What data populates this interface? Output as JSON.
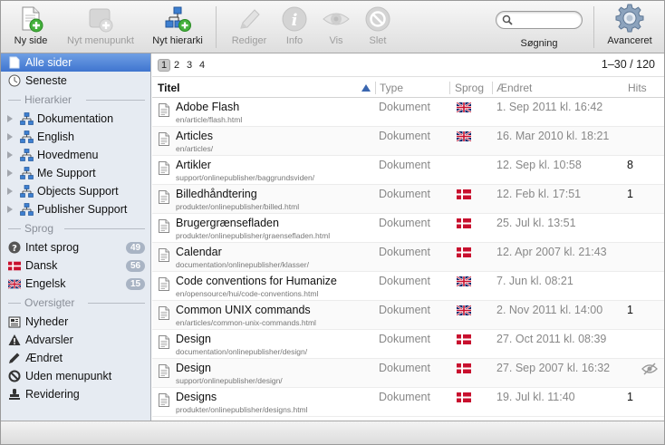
{
  "toolbar": {
    "new_page": "Ny side",
    "new_menu_item": "Nyt menupunkt",
    "new_hierarchy": "Nyt hierarki",
    "edit": "Rediger",
    "info": "Info",
    "view": "Vis",
    "delete": "Slet",
    "search_label": "Søgning",
    "search_value": "",
    "advanced": "Avanceret"
  },
  "sidebar": {
    "all_pages": "Alle sider",
    "recent": "Seneste",
    "hierarchies_heading": "Hierarkier",
    "hierarchies": [
      "Dokumentation",
      "English",
      "Hovedmenu",
      "Me Support",
      "Objects Support",
      "Publisher Support"
    ],
    "languages_heading": "Sprog",
    "languages": [
      {
        "label": "Intet sprog",
        "count": "49"
      },
      {
        "label": "Dansk",
        "count": "56"
      },
      {
        "label": "Engelsk",
        "count": "15"
      }
    ],
    "overviews_heading": "Oversigter",
    "overviews": [
      "Nyheder",
      "Advarsler",
      "Ændret",
      "Uden menupunkt",
      "Revidering"
    ]
  },
  "pager": {
    "pages": [
      "1",
      "2",
      "3",
      "4"
    ],
    "current": "1",
    "range": "1–30 / 120"
  },
  "table": {
    "columns": {
      "title": "Titel",
      "type": "Type",
      "language": "Sprog",
      "changed": "Ændret",
      "hits": "Hits"
    },
    "rows": [
      {
        "title": "Adobe Flash",
        "path": "en/article/flash.html",
        "type": "Dokument",
        "lang": "en",
        "changed": "1. Sep 2011 kl. 16:42",
        "hits": ""
      },
      {
        "title": "Articles",
        "path": "en/articles/",
        "type": "Dokument",
        "lang": "en",
        "changed": "16. Mar 2010 kl. 18:21",
        "hits": ""
      },
      {
        "title": "Artikler",
        "path": "support/onlinepublisher/baggrundsviden/",
        "type": "Dokument",
        "lang": "",
        "changed": "12. Sep kl. 10:58",
        "hits": "8"
      },
      {
        "title": "Billedhåndtering",
        "path": "produkter/onlinepublisher/billed.html",
        "type": "Dokument",
        "lang": "da",
        "changed": "12. Feb kl. 17:51",
        "hits": "1"
      },
      {
        "title": "Brugergrænsefladen",
        "path": "produkter/onlinepublisher/graensefladen.html",
        "type": "Dokument",
        "lang": "da",
        "changed": "25. Jul kl. 13:51",
        "hits": ""
      },
      {
        "title": "Calendar",
        "path": "documentation/onlinepublisher/klasser/",
        "type": "Dokument",
        "lang": "da",
        "changed": "12. Apr 2007 kl. 21:43",
        "hits": ""
      },
      {
        "title": "Code conventions for Humanize",
        "path": "en/opensource/hui/code-conventions.html",
        "type": "Dokument",
        "lang": "en",
        "changed": "7. Jun kl. 08:21",
        "hits": ""
      },
      {
        "title": "Common UNIX commands",
        "path": "en/articles/common-unix-commands.html",
        "type": "Dokument",
        "lang": "en",
        "changed": "2. Nov 2011 kl. 14:00",
        "hits": "1"
      },
      {
        "title": "Design",
        "path": "documentation/onlinepublisher/design/",
        "type": "Dokument",
        "lang": "da",
        "changed": "27. Oct 2011 kl. 08:39",
        "hits": ""
      },
      {
        "title": "Design",
        "path": "support/onlinepublisher/design/",
        "type": "Dokument",
        "lang": "da",
        "changed": "27. Sep 2007 kl. 16:32",
        "hits": "",
        "hidden": true
      },
      {
        "title": "Designs",
        "path": "produkter/onlinepublisher/designs.html",
        "type": "Dokument",
        "lang": "da",
        "changed": "19. Jul kl. 11:40",
        "hits": "1"
      }
    ]
  },
  "colors": {
    "selection": "#4a7fd6",
    "sidebar_bg": "#e6ebf2",
    "badge": "#a9b4c4",
    "dk_red": "#c8102e",
    "uk_blue": "#012169"
  }
}
